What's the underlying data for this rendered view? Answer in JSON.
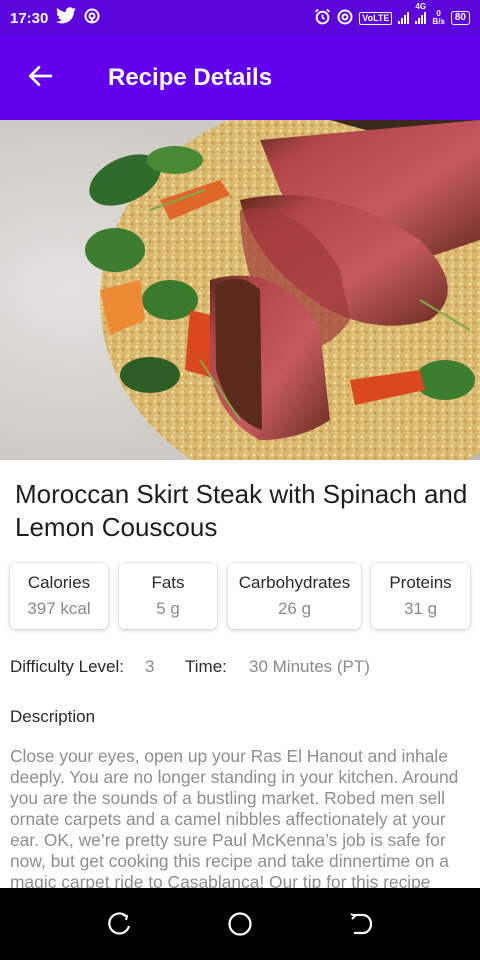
{
  "status_bar": {
    "time": "17:30",
    "icons_left": [
      "twitter-icon",
      "hotspot-icon"
    ],
    "icons_right": [
      "alarm-icon",
      "hotspot-icon",
      "volte-badge",
      "signal-icon",
      "signal-4g-icon",
      "data-speed",
      "battery-icon"
    ],
    "volte_text": "VoLTE",
    "network_text": "4G",
    "data_speed_value": "0",
    "data_speed_unit": "B/s",
    "battery_level": "80"
  },
  "app_bar": {
    "title": "Recipe Details",
    "back_icon": "arrow-back-icon",
    "color": "#6200ee"
  },
  "recipe": {
    "title": "Moroccan Skirt Steak with Spinach and Lemon Couscous",
    "nutrients": [
      {
        "label": "Calories",
        "value": "397 kcal"
      },
      {
        "label": "Fats",
        "value": "5 g"
      },
      {
        "label": "Carbohydrates",
        "value": "26 g"
      },
      {
        "label": "Proteins",
        "value": "31 g"
      }
    ],
    "difficulty_label": "Difficulty Level:",
    "difficulty_value": "3",
    "time_label": "Time:",
    "time_value": "30 Minutes (PT)",
    "description_heading": "Description",
    "description": "Close your eyes, open up your Ras El Hanout and inhale deeply. You are no longer standing in your kitchen. Around you are the sounds of a bustling market. Robed men sell ornate carpets and a camel nibbles affectionately at your ear.  OK, we’re pretty sure Paul McKenna’s job is safe for now, but get cooking this recipe and take dinnertime on a magic carpet ride to Casablanca! Our tip for this recipe"
  },
  "nav_bar": {
    "buttons": [
      "recents-icon",
      "home-icon",
      "back-icon"
    ]
  }
}
